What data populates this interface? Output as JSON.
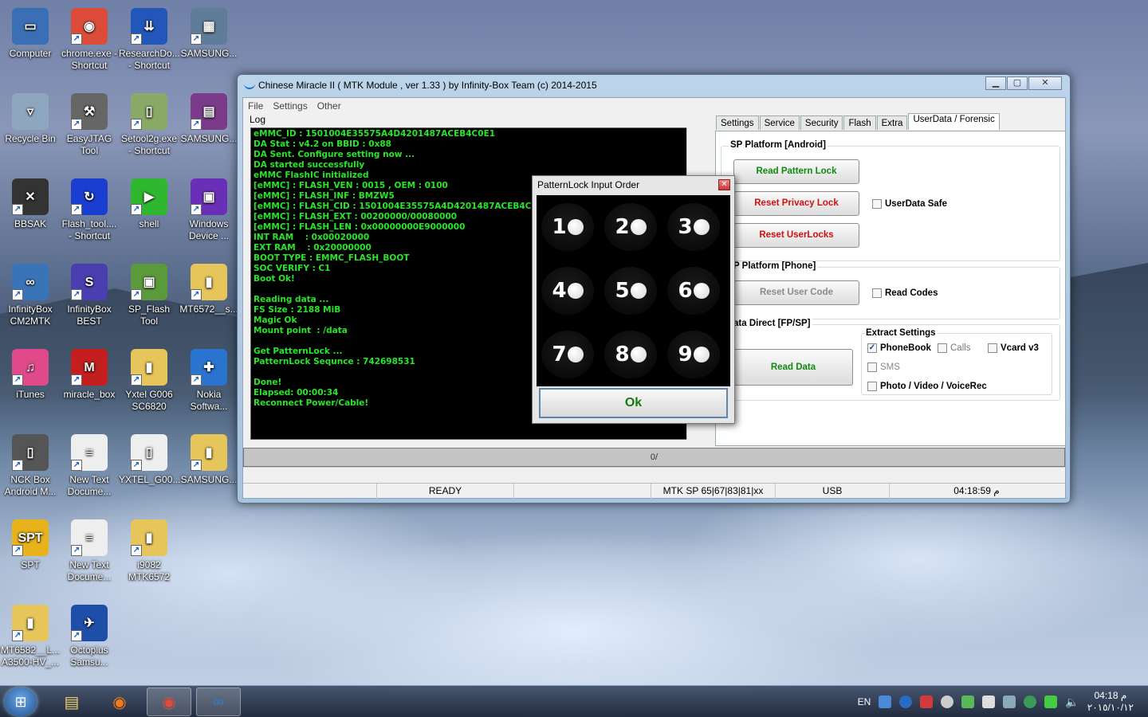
{
  "desktop": {
    "icons": [
      {
        "label": "Computer",
        "glyph": "▭",
        "color": "#3b6fb5"
      },
      {
        "label": "chrome.exe - Shortcut",
        "glyph": "◉",
        "color": "#dd4b39"
      },
      {
        "label": "ResearchDo... - Shortcut",
        "glyph": "⇊",
        "color": "#2256b8"
      },
      {
        "label": "SAMSUNG...",
        "glyph": "▦",
        "color": "#5f7d99"
      },
      {
        "label": "Recycle Bin",
        "glyph": "▿",
        "color": "#8fa6bf"
      },
      {
        "label": "EasyJTAG Tool",
        "glyph": "⚒",
        "color": "#666"
      },
      {
        "label": "Setool2g.exe - Shortcut",
        "glyph": "▯",
        "color": "#8a6"
      },
      {
        "label": "SAMSUNG...",
        "glyph": "▤",
        "color": "#7a3b8a"
      },
      {
        "label": "BBSAK",
        "glyph": "✕",
        "color": "#333"
      },
      {
        "label": "Flash_tool.... - Shortcut",
        "glyph": "↻",
        "color": "#1a3fd0"
      },
      {
        "label": "shell",
        "glyph": "▶",
        "color": "#2fb82f"
      },
      {
        "label": "Windows Device ...",
        "glyph": "▣",
        "color": "#6a2fb8"
      },
      {
        "label": "InfinityBox CM2MTK",
        "glyph": "∞",
        "color": "#3a74b8"
      },
      {
        "label": "InfinityBox BEST",
        "glyph": "S",
        "color": "#4a3fb0"
      },
      {
        "label": "SP_Flash Tool",
        "glyph": "▣",
        "color": "#5a9a3a"
      },
      {
        "label": "MT6572__s...",
        "glyph": "▮",
        "color": "#e6c55a"
      },
      {
        "label": "iTunes",
        "glyph": "♫",
        "color": "#e04a8a"
      },
      {
        "label": "miracle_box",
        "glyph": "M",
        "color": "#c41e1e"
      },
      {
        "label": "Yxtel G006 SC6820",
        "glyph": "▮",
        "color": "#e6c55a"
      },
      {
        "label": "Nokia Softwa...",
        "glyph": "✚",
        "color": "#2a74d0"
      },
      {
        "label": "NCK Box Android M...",
        "glyph": "▯",
        "color": "#555"
      },
      {
        "label": "New Text Docume...",
        "glyph": "≡",
        "color": "#eee"
      },
      {
        "label": "YXTEL_G00...",
        "glyph": "▯",
        "color": "#eee"
      },
      {
        "label": "SAMSUNG...",
        "glyph": "▮",
        "color": "#e6c55a"
      },
      {
        "label": "SPT",
        "glyph": "SPT",
        "color": "#e8b21a"
      },
      {
        "label": "New Text Docume...",
        "glyph": "≡",
        "color": "#eee"
      },
      {
        "label": "i9082 MTK6572",
        "glyph": "▮",
        "color": "#e6c55a"
      },
      {
        "label": "MT6582__L... A3500-HV_...",
        "glyph": "▮",
        "color": "#e6c55a"
      },
      {
        "label": "Octoplus Samsu...",
        "glyph": "✈",
        "color": "#1e4fa8"
      }
    ]
  },
  "window": {
    "title": "Chinese Miracle II ( MTK Module , ver 1.33 ) by Infinity-Box Team (c) 2014-2015",
    "menu": [
      "File",
      "Settings",
      "Other"
    ],
    "log_label": "Log",
    "log_lines": [
      "eMMC_ID : 1501004E35575A4D4201487ACEB4C0E1",
      "DA Stat : v4.2 on BBID : 0x88",
      "DA Sent. Configure setting now ...",
      "DA started successfully",
      "eMMC FlashIC initialized",
      "[eMMC] : FLASH_VEN : 0015 , OEM : 0100",
      "[eMMC] : FLASH_INF : BMZW5",
      "[eMMC] : FLASH_CID : 1501004E35575A4D4201487ACEB4C0E1",
      "[eMMC] : FLASH_EXT : 00200000/00080000",
      "[eMMC] : FLASH_LEN : 0x00000000E9000000",
      "INT RAM    : 0x00020000",
      "EXT RAM    : 0x20000000",
      "BOOT TYPE : EMMC_FLASH_BOOT",
      "SOC VERIFY : C1",
      "Boot Ok!",
      "",
      "Reading data ...",
      "FS Size : 2188 MiB",
      "Magic Ok",
      "Mount point  : /data",
      "",
      "Get PatternLock ...",
      "PatternLock Sequnce : 742698531",
      "",
      "Done!",
      "Elapsed: 00:00:34",
      "Reconnect Power/Cable!"
    ],
    "tabs": [
      "Settings",
      "Service",
      "Security",
      "Flash",
      "Extra",
      "UserData / Forensic"
    ],
    "group_android": "SP Platform [Android]",
    "btn_read_pattern": "Read Pattern Lock",
    "btn_reset_privacy": "Reset Privacy Lock",
    "btn_reset_userlocks": "Reset UserLocks",
    "chk_userdata_safe": "UserData Safe",
    "group_phone": "P Platform [Phone]",
    "btn_reset_user_code": "Reset User Code",
    "chk_read_codes": "Read Codes",
    "group_data_direct": "ata Direct  [FP/SP]",
    "btn_read_data": "Read Data",
    "extract_settings": "Extract Settings",
    "chk_phonebook": "PhoneBook",
    "chk_calls": "Calls",
    "chk_vcard": "Vcard v3",
    "chk_sms": "SMS",
    "chk_photo": "Photo / Video / VoiceRec",
    "progress_text": "0/",
    "status": [
      "",
      "READY",
      "",
      "MTK SP 65|67|83|81|xx",
      "USB",
      "04:18:59 م"
    ],
    "btn_colors": {
      "green": "#0f8a0f",
      "red": "#d01010",
      "gray": "#8a8a8a"
    }
  },
  "dialog": {
    "title": "PatternLock Input Order",
    "keys": [
      "1",
      "2",
      "3",
      "4",
      "5",
      "6",
      "7",
      "8",
      "9"
    ],
    "ok_label": "Ok"
  },
  "taskbar": {
    "lang": "EN",
    "time": "04:18 م",
    "date": "٢٠١٥/١٠/١٢"
  }
}
